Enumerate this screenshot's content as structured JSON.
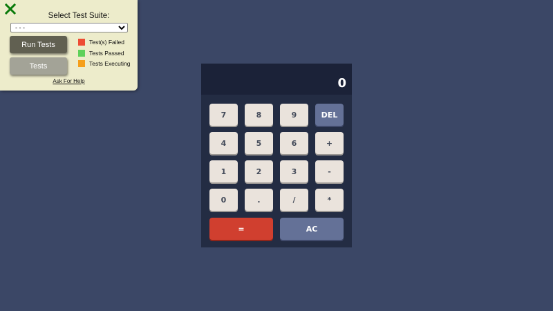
{
  "test_panel": {
    "title": "Select Test Suite:",
    "select_value": "- - -",
    "run_button": "Run Tests",
    "tests_button": "Tests",
    "legend": [
      {
        "label": "Test(s) Failed",
        "color": "#ee4c34"
      },
      {
        "label": "Tests Passed",
        "color": "#5ed15a"
      },
      {
        "label": "Tests Executing",
        "color": "#f59f1a"
      }
    ],
    "help_link": "Ask For Help",
    "close_icon": "close-x-icon",
    "close_color": "#0a7a0a"
  },
  "calculator": {
    "display": "0",
    "keys": {
      "seven": "7",
      "eight": "8",
      "nine": "9",
      "del": "DEL",
      "four": "4",
      "five": "5",
      "six": "6",
      "plus": "+",
      "one": "1",
      "two": "2",
      "three": "3",
      "minus": "-",
      "zero": "0",
      "dot": ".",
      "divide": "/",
      "multiply": "*",
      "equals": "=",
      "ac": "AC"
    },
    "colors": {
      "key": "#eae3dc",
      "key_blue": "#647197",
      "key_red": "#d03f2f",
      "body": "#232c43",
      "display": "#1b2238",
      "page_bg": "#3b4766"
    }
  }
}
